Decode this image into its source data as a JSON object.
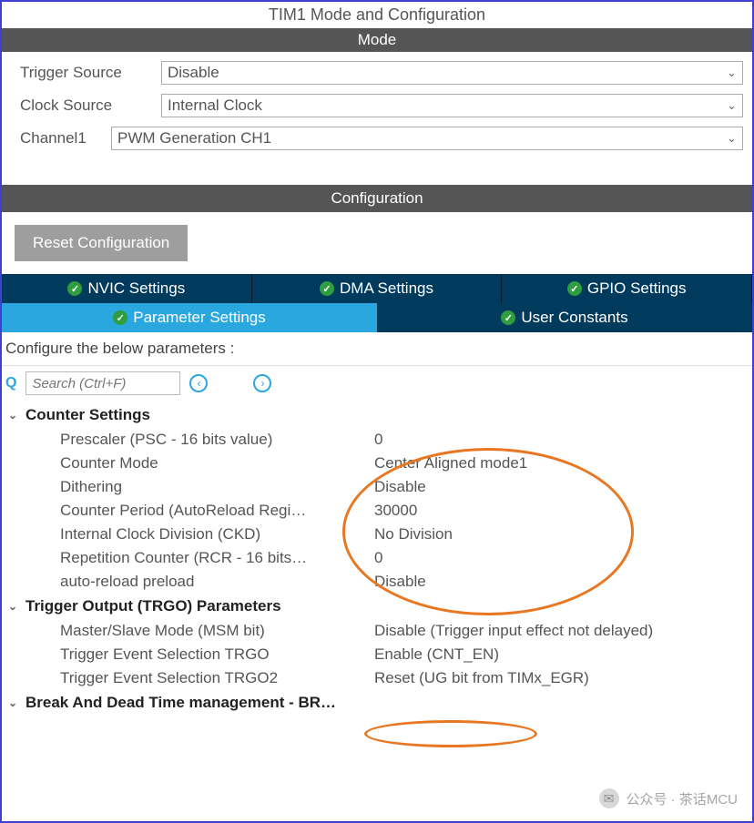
{
  "window_title": "TIM1 Mode and Configuration",
  "section_mode": "Mode",
  "mode": {
    "trigger_source_label": "Trigger Source",
    "trigger_source_value": "Disable",
    "clock_source_label": "Clock Source",
    "clock_source_value": "Internal Clock",
    "channel1_label": "Channel1",
    "channel1_value": "PWM Generation CH1"
  },
  "section_configuration": "Configuration",
  "reset_button": "Reset Configuration",
  "tabs_row1": {
    "nvic": "NVIC Settings",
    "dma": "DMA Settings",
    "gpio": "GPIO Settings"
  },
  "tabs_row2": {
    "parameter": "Parameter Settings",
    "user_constants": "User Constants"
  },
  "param_hint": "Configure the below parameters :",
  "search_placeholder": "Search (Ctrl+F)",
  "groups": {
    "counter": {
      "title": "Counter Settings",
      "rows": [
        {
          "label": "Prescaler (PSC - 16 bits value)",
          "value": "0"
        },
        {
          "label": "Counter Mode",
          "value": "Center Aligned mode1"
        },
        {
          "label": "Dithering",
          "value": "Disable"
        },
        {
          "label": "Counter Period (AutoReload Regi…",
          "value": "30000"
        },
        {
          "label": "Internal Clock Division (CKD)",
          "value": "No Division"
        },
        {
          "label": "Repetition Counter (RCR - 16 bits…",
          "value": "0"
        },
        {
          "label": "auto-reload preload",
          "value": "Disable"
        }
      ]
    },
    "trgo": {
      "title": "Trigger Output (TRGO) Parameters",
      "rows": [
        {
          "label": "Master/Slave Mode (MSM bit)",
          "value": "Disable (Trigger input effect not delayed)"
        },
        {
          "label": "Trigger Event Selection TRGO",
          "value": "Enable (CNT_EN)"
        },
        {
          "label": "Trigger Event Selection TRGO2",
          "value": "Reset (UG bit from TIMx_EGR)"
        }
      ]
    },
    "break": {
      "title": "Break And Dead Time management - BR…"
    }
  },
  "watermark": "公众号 · 茶话MCU"
}
